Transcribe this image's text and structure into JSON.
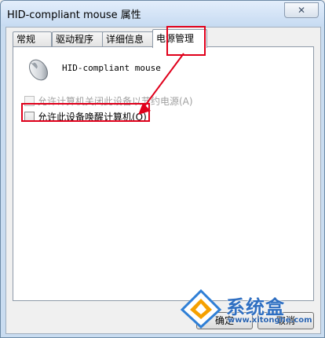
{
  "window": {
    "title": "HID-compliant mouse 属性",
    "close_icon": "close-icon"
  },
  "tabs": [
    {
      "label": "常规"
    },
    {
      "label": "驱动程序"
    },
    {
      "label": "详细信息"
    },
    {
      "label": "电源管理",
      "active": true
    }
  ],
  "device": {
    "name": "HID-compliant mouse",
    "icon": "mouse-icon"
  },
  "options": [
    {
      "label": "允许计算机关闭此设备以节约电源(A)",
      "checked": false,
      "enabled": false
    },
    {
      "label": "允许此设备唤醒计算机(O)",
      "checked": false,
      "enabled": true
    }
  ],
  "buttons": {
    "ok_label": "确定",
    "cancel_label": "取消"
  },
  "watermark": {
    "brand": "系统盒",
    "url": "www.xitonghe.com"
  },
  "annotation_color": "#e0001b"
}
